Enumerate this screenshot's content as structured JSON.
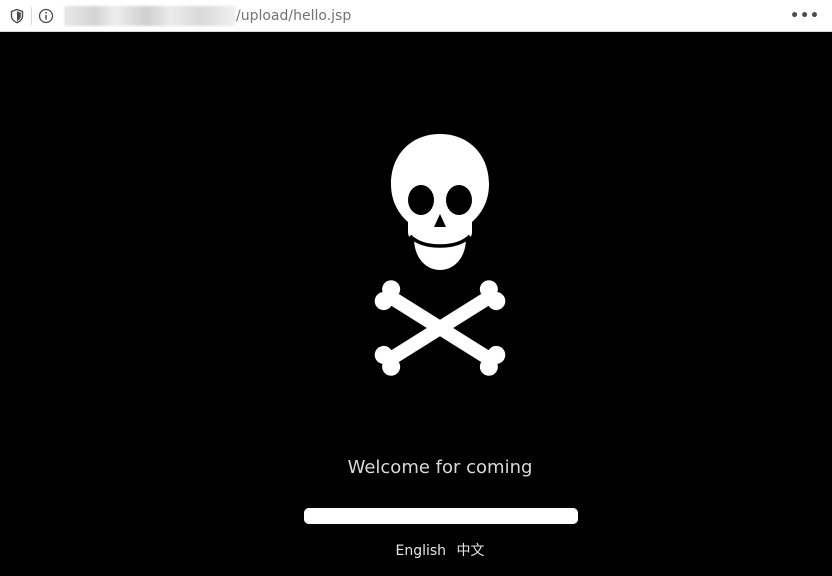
{
  "browser": {
    "url_path": "/upload/hello.jsp",
    "menu_label": "•••",
    "icons": [
      "shield-icon",
      "info-icon",
      "more-icon"
    ]
  },
  "page": {
    "welcome_text": "Welcome for coming",
    "progress": 1.0,
    "languages": [
      "English",
      "中文"
    ],
    "colors": {
      "background": "#000000",
      "foreground": "#ffffff",
      "text": "#d9d9d9"
    },
    "graphic": "skull-and-crossbones-icon"
  }
}
